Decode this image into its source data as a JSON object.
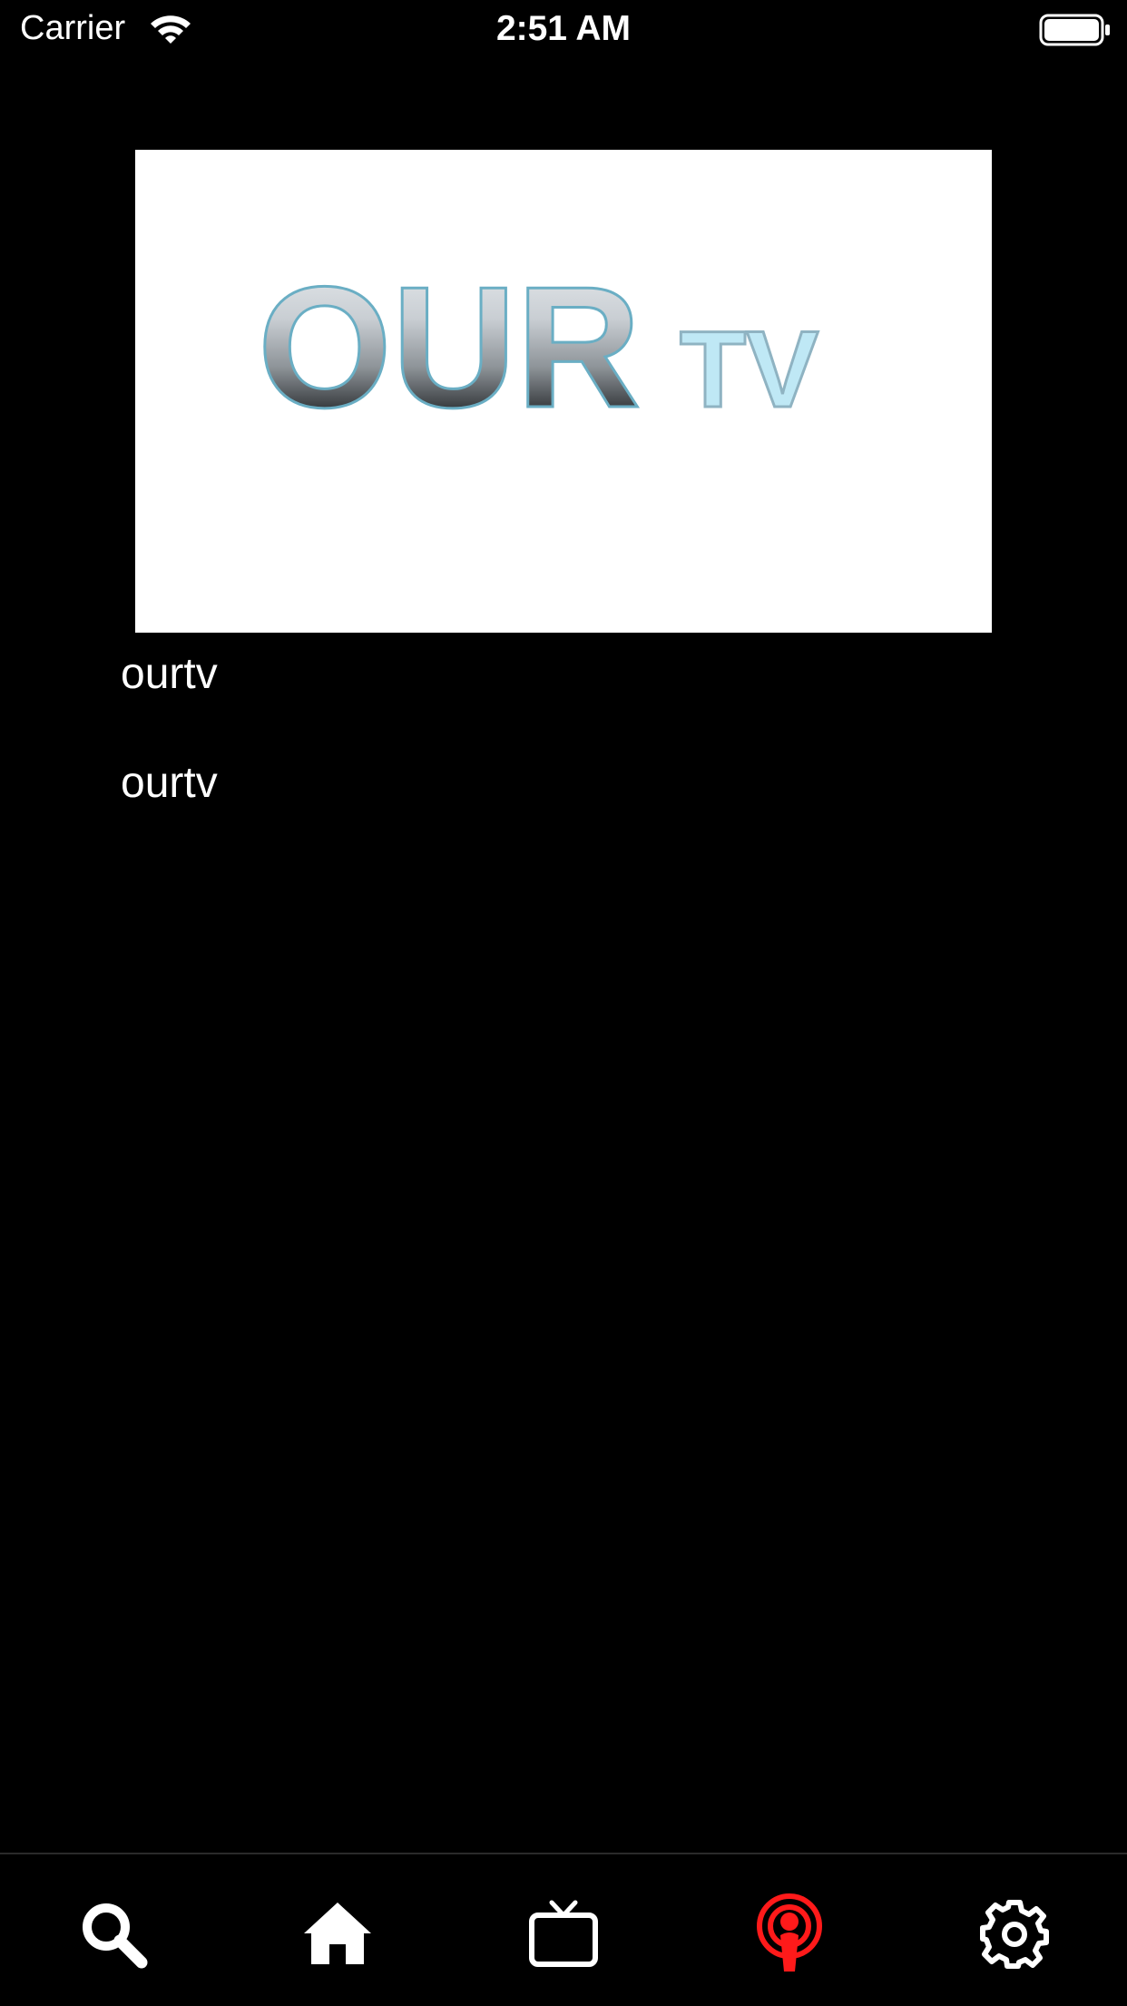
{
  "status_bar": {
    "carrier": "Carrier",
    "time": "2:51 AM",
    "icons": [
      "wifi-icon",
      "battery-icon"
    ]
  },
  "logo": {
    "text_primary": "OUR",
    "text_secondary": "TV",
    "secondary_color": "#bfe8f5"
  },
  "list": {
    "items": [
      {
        "label": "ourtv"
      },
      {
        "label": "ourtv"
      }
    ]
  },
  "tab_bar": {
    "tabs": [
      {
        "icon": "search-icon",
        "active": false
      },
      {
        "icon": "home-icon",
        "active": false
      },
      {
        "icon": "tv-icon",
        "active": false
      },
      {
        "icon": "podcast-icon",
        "active": true
      },
      {
        "icon": "gear-icon",
        "active": false
      }
    ],
    "active_color": "#ff1a1a",
    "inactive_color": "#ffffff"
  }
}
